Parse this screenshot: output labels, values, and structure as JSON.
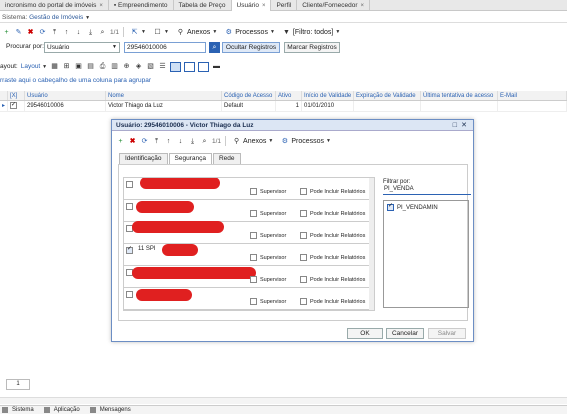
{
  "tabs": [
    {
      "label": "incronismo do portal de imóveis",
      "active": false
    },
    {
      "label": "Empreendimento",
      "active": false
    },
    {
      "label": "Tabela de Preço",
      "active": false
    },
    {
      "label": "Usuário",
      "active": true
    },
    {
      "label": "Perfil",
      "active": false
    },
    {
      "label": "Cliente/Fornecedor",
      "active": false
    }
  ],
  "module": {
    "prefix": "Sistema:",
    "value": "Gestão de Imóveis"
  },
  "toolbar": {
    "page_indicator": "1/1",
    "anexos_label": "Anexos",
    "processos_label": "Processos",
    "filter_label": "[Filtro: todos]"
  },
  "search": {
    "label": "Procurar por:",
    "field_value": "Usuário",
    "query_value": "29546010006",
    "hide_button": "Ocultar Registros",
    "mark_button": "Marcar Registros"
  },
  "layout_toolbar": {
    "label1": "ayout:",
    "label2": "Layout"
  },
  "group_hint": "rraste aqui o cabeçalho de uma coluna para agrupar",
  "grid": {
    "headers": [
      "[X]",
      "Usuário",
      "Nome",
      "Código de Acesso",
      "Ativo",
      "Início de Validade",
      "Expiração de Validade",
      "Última tentativa de acesso",
      "E-Mail"
    ],
    "rows": [
      {
        "checked": true,
        "usuario": "29546010006",
        "nome": "Victor Thiago da Luz",
        "codigo": "Default",
        "ativo": "1",
        "inicio": "01/01/2010",
        "expiracao": "",
        "ultima": "",
        "email": ""
      }
    ]
  },
  "pager": {
    "page": "1"
  },
  "statusbar": {
    "items": [
      "Sistema",
      "Aplicação",
      "Mensagens"
    ]
  },
  "dialog": {
    "title": "Usuário: 29546010006 - Victor Thiago da Luz",
    "page_indicator": "1/1",
    "anexos_label": "Anexos",
    "processos_label": "Processos",
    "tabs": [
      "Identificação",
      "Segurança",
      "Rede"
    ],
    "active_tab": "Segurança",
    "permissions": [
      {
        "code": "",
        "checked": false,
        "supervisor": "Supervisor",
        "relatorios": "Pode Incluir Relatórios"
      },
      {
        "code": "",
        "checked": false,
        "supervisor": "Supervisor",
        "relatorios": "Pode Incluir Relatórios"
      },
      {
        "code": "",
        "checked": false,
        "supervisor": "Supervisor",
        "relatorios": "Pode Incluir Relatórios"
      },
      {
        "code": "11  SPI",
        "checked": true,
        "supervisor": "Supervisor",
        "relatorios": "Pode Incluir Relatórios"
      },
      {
        "code": "",
        "checked": false,
        "supervisor": "Supervisor",
        "relatorios": "Pode Incluir Relatórios"
      },
      {
        "code": "",
        "checked": false,
        "supervisor": "Supervisor",
        "relatorios": "Pode Incluir Relatórios"
      }
    ],
    "filter_label": "Filtrar por:",
    "filter_value": "PI_VENDA",
    "roles": [
      {
        "label": "PI_VENDAMIN",
        "checked": true
      }
    ],
    "ok_label": "OK",
    "cancel_label": "Cancelar",
    "save_label": "Salvar"
  }
}
